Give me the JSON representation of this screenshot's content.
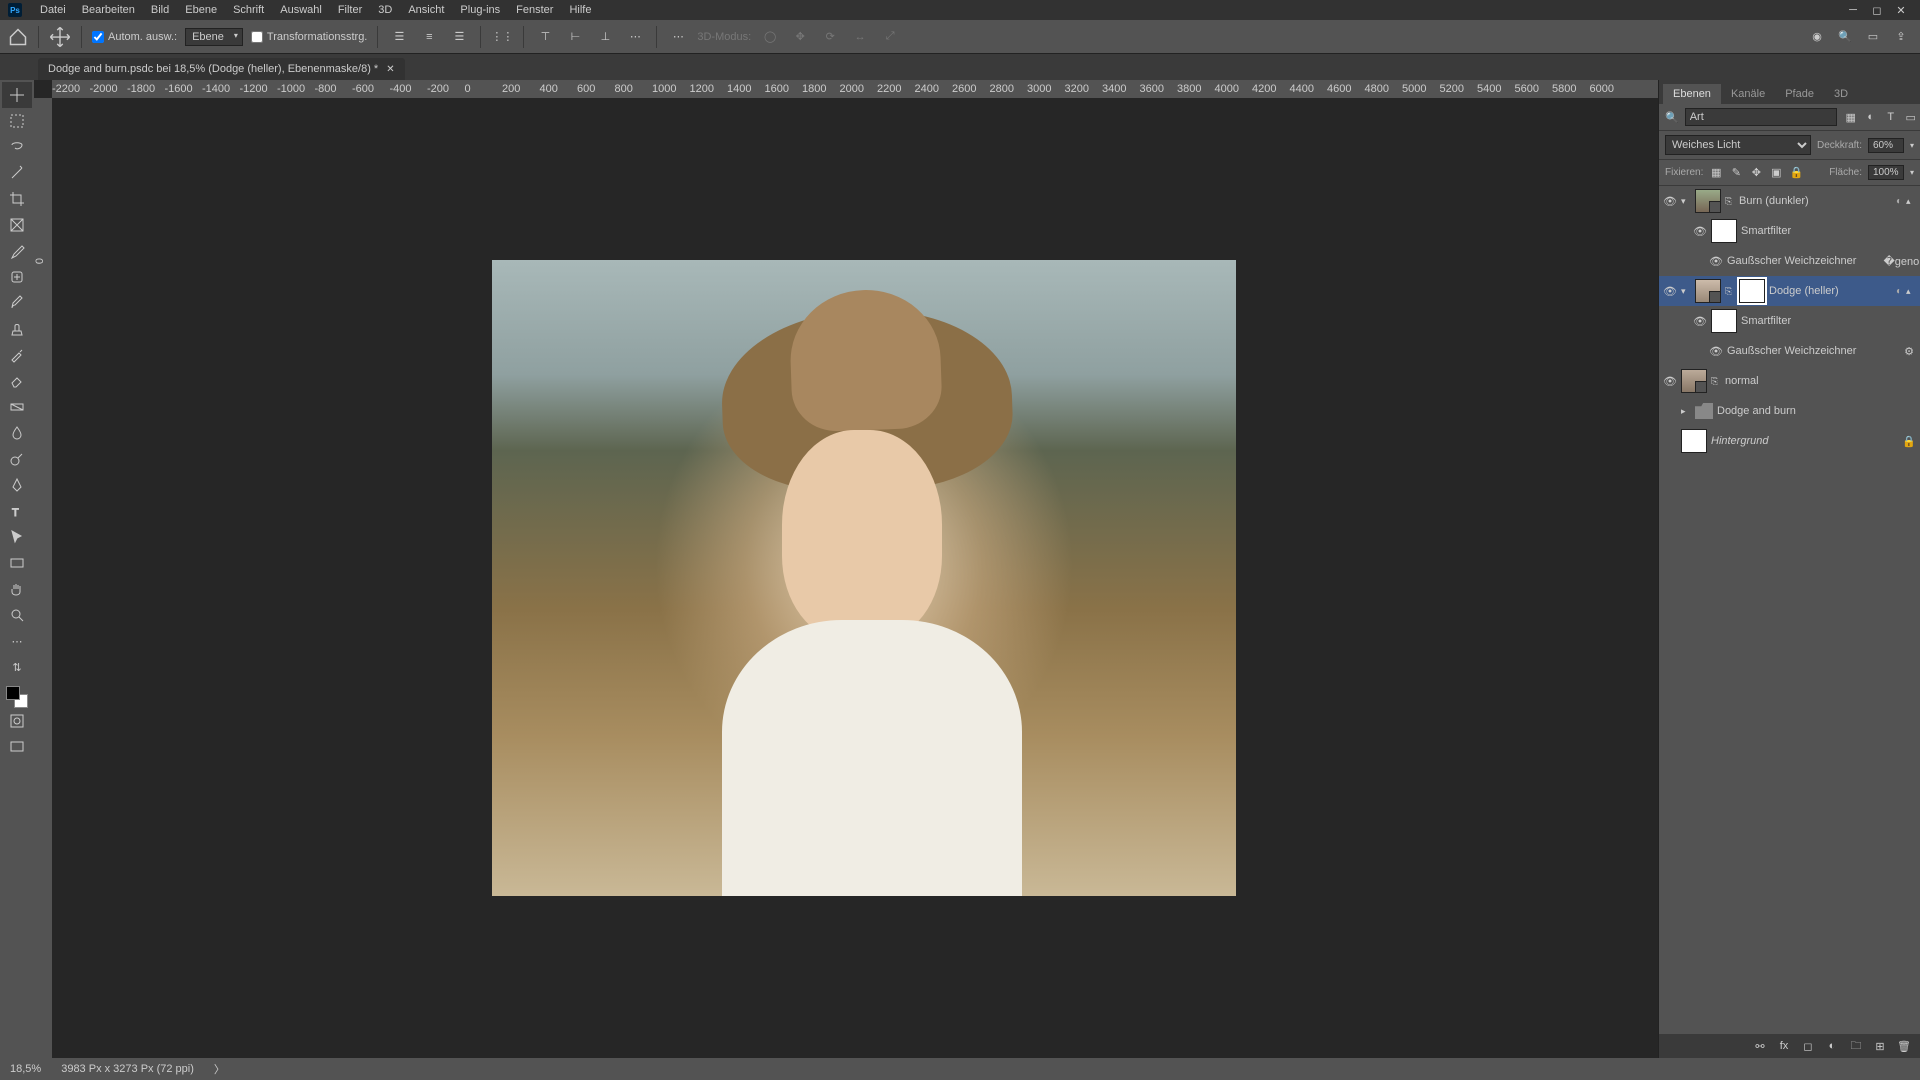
{
  "app": {
    "logo": "Ps"
  },
  "menu": [
    "Datei",
    "Bearbeiten",
    "Bild",
    "Ebene",
    "Schrift",
    "Auswahl",
    "Filter",
    "3D",
    "Ansicht",
    "Plug-ins",
    "Fenster",
    "Hilfe"
  ],
  "options": {
    "auto_select": "Autom. ausw.:",
    "target": "Ebene",
    "transform": "Transformationsstrg.",
    "mode3d": "3D-Modus:"
  },
  "document": {
    "tab": "Dodge and burn.psdc bei 18,5% (Dodge (heller), Ebenenmaske/8) *"
  },
  "ruler_h": [
    "-2200",
    "-2000",
    "-1800",
    "-1600",
    "-1400",
    "-1200",
    "-1000",
    "-800",
    "-600",
    "-400",
    "-200",
    "0",
    "200",
    "400",
    "600",
    "800",
    "1000",
    "1200",
    "1400",
    "1600",
    "1800",
    "2000",
    "2200",
    "2400",
    "2600",
    "2800",
    "3000",
    "3200",
    "3400",
    "3600",
    "3800",
    "4000",
    "4200",
    "4400",
    "4600",
    "4800",
    "5000",
    "5200",
    "5400",
    "5600",
    "5800",
    "6000"
  ],
  "ruler_v": [
    "0"
  ],
  "panels": {
    "tabs": [
      "Ebenen",
      "Kanäle",
      "Pfade",
      "3D"
    ],
    "active_tab": 0,
    "search_label": "Art",
    "blend_mode": "Weiches Licht",
    "opacity_label": "Deckkraft:",
    "opacity_value": "60%",
    "lock_label": "Fixieren:",
    "fill_label": "Fläche:",
    "fill_value": "100%"
  },
  "layers": [
    {
      "type": "smart",
      "name": "Burn (dunkler)",
      "visible": true,
      "has_mask": false,
      "fx": true,
      "selected": false
    },
    {
      "type": "sf-header",
      "name": "Smartfilter",
      "visible": true
    },
    {
      "type": "sf-item",
      "name": "Gaußscher Weichzeichner",
      "visible": true
    },
    {
      "type": "smart",
      "name": "Dodge (heller)",
      "visible": true,
      "has_mask": true,
      "fx": true,
      "selected": true
    },
    {
      "type": "sf-header",
      "name": "Smartfilter",
      "visible": true
    },
    {
      "type": "sf-item",
      "name": "Gaußscher Weichzeichner",
      "visible": true
    },
    {
      "type": "smart",
      "name": "normal",
      "visible": true,
      "has_mask": false,
      "selected": false
    },
    {
      "type": "group",
      "name": "Dodge and burn",
      "visible": false,
      "expanded": false
    },
    {
      "type": "bg",
      "name": "Hintergrund",
      "visible": false,
      "locked": true
    }
  ],
  "status": {
    "zoom": "18,5%",
    "dims": "3983 Px x 3273 Px (72 ppi)"
  }
}
